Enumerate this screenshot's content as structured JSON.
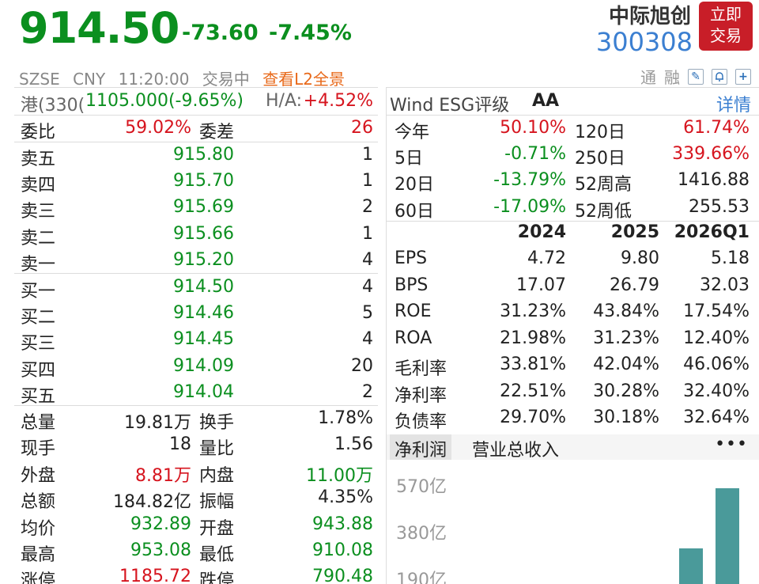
{
  "header": {
    "price": "914.50",
    "change": "-73.60",
    "change_pct": "-7.45%",
    "stock_name": "中际旭创",
    "stock_code": "300308",
    "trade_button_line1": "立即",
    "trade_button_line2": "交易",
    "exchange": "SZSE",
    "currency": "CNY",
    "time": "11:20:00",
    "status": "交易中",
    "l2_link": "查看L2全景",
    "tool_label1": "通",
    "tool_label2": "融"
  },
  "hk_row": {
    "label": "港(330(",
    "value": "1105.000(-9.65%)",
    "ha_label": "H/A:",
    "ha_value": "+4.52%"
  },
  "order_ratio": {
    "label1": "委比",
    "value1": "59.02%",
    "label2": "委差",
    "value2": "26"
  },
  "asks": [
    {
      "label": "卖五",
      "price": "915.80",
      "vol": "1"
    },
    {
      "label": "卖四",
      "price": "915.70",
      "vol": "1"
    },
    {
      "label": "卖三",
      "price": "915.69",
      "vol": "2"
    },
    {
      "label": "卖二",
      "price": "915.66",
      "vol": "1"
    },
    {
      "label": "卖一",
      "price": "915.20",
      "vol": "4"
    }
  ],
  "bids": [
    {
      "label": "买一",
      "price": "914.50",
      "vol": "4"
    },
    {
      "label": "买二",
      "price": "914.46",
      "vol": "5"
    },
    {
      "label": "买三",
      "price": "914.45",
      "vol": "4"
    },
    {
      "label": "买四",
      "price": "914.09",
      "vol": "20"
    },
    {
      "label": "买五",
      "price": "914.04",
      "vol": "2"
    }
  ],
  "stats": [
    {
      "l1": "总量",
      "v1": "19.81万",
      "l2": "换手",
      "v2": "1.78%"
    },
    {
      "l1": "现手",
      "v1": "18",
      "l2": "量比",
      "v2": "1.56"
    },
    {
      "l1": "外盘",
      "v1": "8.81万",
      "l2": "内盘",
      "v2": "11.00万"
    },
    {
      "l1": "总额",
      "v1": "184.82亿",
      "l2": "振幅",
      "v2": "4.35%"
    },
    {
      "l1": "均价",
      "v1": "932.89",
      "l2": "开盘",
      "v2": "943.88"
    },
    {
      "l1": "最高",
      "v1": "953.08",
      "l2": "最低",
      "v2": "910.08"
    },
    {
      "l1": "涨停",
      "v1": "1185.72",
      "l2": "跌停",
      "v2": "790.48"
    }
  ],
  "esg": {
    "label": "Wind ESG评级",
    "rating": "AA",
    "detail_link": "详情"
  },
  "performance": [
    {
      "l1": "今年",
      "v1": "50.10%",
      "l2": "120日",
      "v2": "61.74%"
    },
    {
      "l1": "5日",
      "v1": "-0.71%",
      "l2": "250日",
      "v2": "339.66%"
    },
    {
      "l1": "20日",
      "v1": "-13.79%",
      "l2": "52周高",
      "v2": "1416.88"
    },
    {
      "l1": "60日",
      "v1": "-17.09%",
      "l2": "52周低",
      "v2": "255.53"
    }
  ],
  "fin_headers": [
    "2024",
    "2025",
    "2026Q1"
  ],
  "financials": [
    {
      "label": "EPS",
      "values": [
        "4.72",
        "9.80",
        "5.18"
      ]
    },
    {
      "label": "BPS",
      "values": [
        "17.07",
        "26.79",
        "32.03"
      ]
    },
    {
      "label": "ROE",
      "values": [
        "31.23%",
        "43.84%",
        "17.54%"
      ]
    },
    {
      "label": "ROA",
      "values": [
        "21.98%",
        "31.23%",
        "12.40%"
      ]
    },
    {
      "label": "毛利率",
      "values": [
        "33.81%",
        "42.04%",
        "46.06%"
      ]
    },
    {
      "label": "净利率",
      "values": [
        "22.51%",
        "30.28%",
        "32.40%"
      ]
    },
    {
      "label": "负债率",
      "values": [
        "29.70%",
        "30.18%",
        "32.64%"
      ]
    }
  ],
  "tabs": {
    "net_profit": "净利润",
    "revenue": "营业总收入",
    "more": "•••"
  },
  "chart_axis": [
    "570亿",
    "380亿",
    "190亿"
  ],
  "colors": {
    "up": "#d6141e",
    "down": "#0b8f1f",
    "accent": "#3b7fd1",
    "bar": "#4a9a9a",
    "trade_button": "#c81e28"
  }
}
